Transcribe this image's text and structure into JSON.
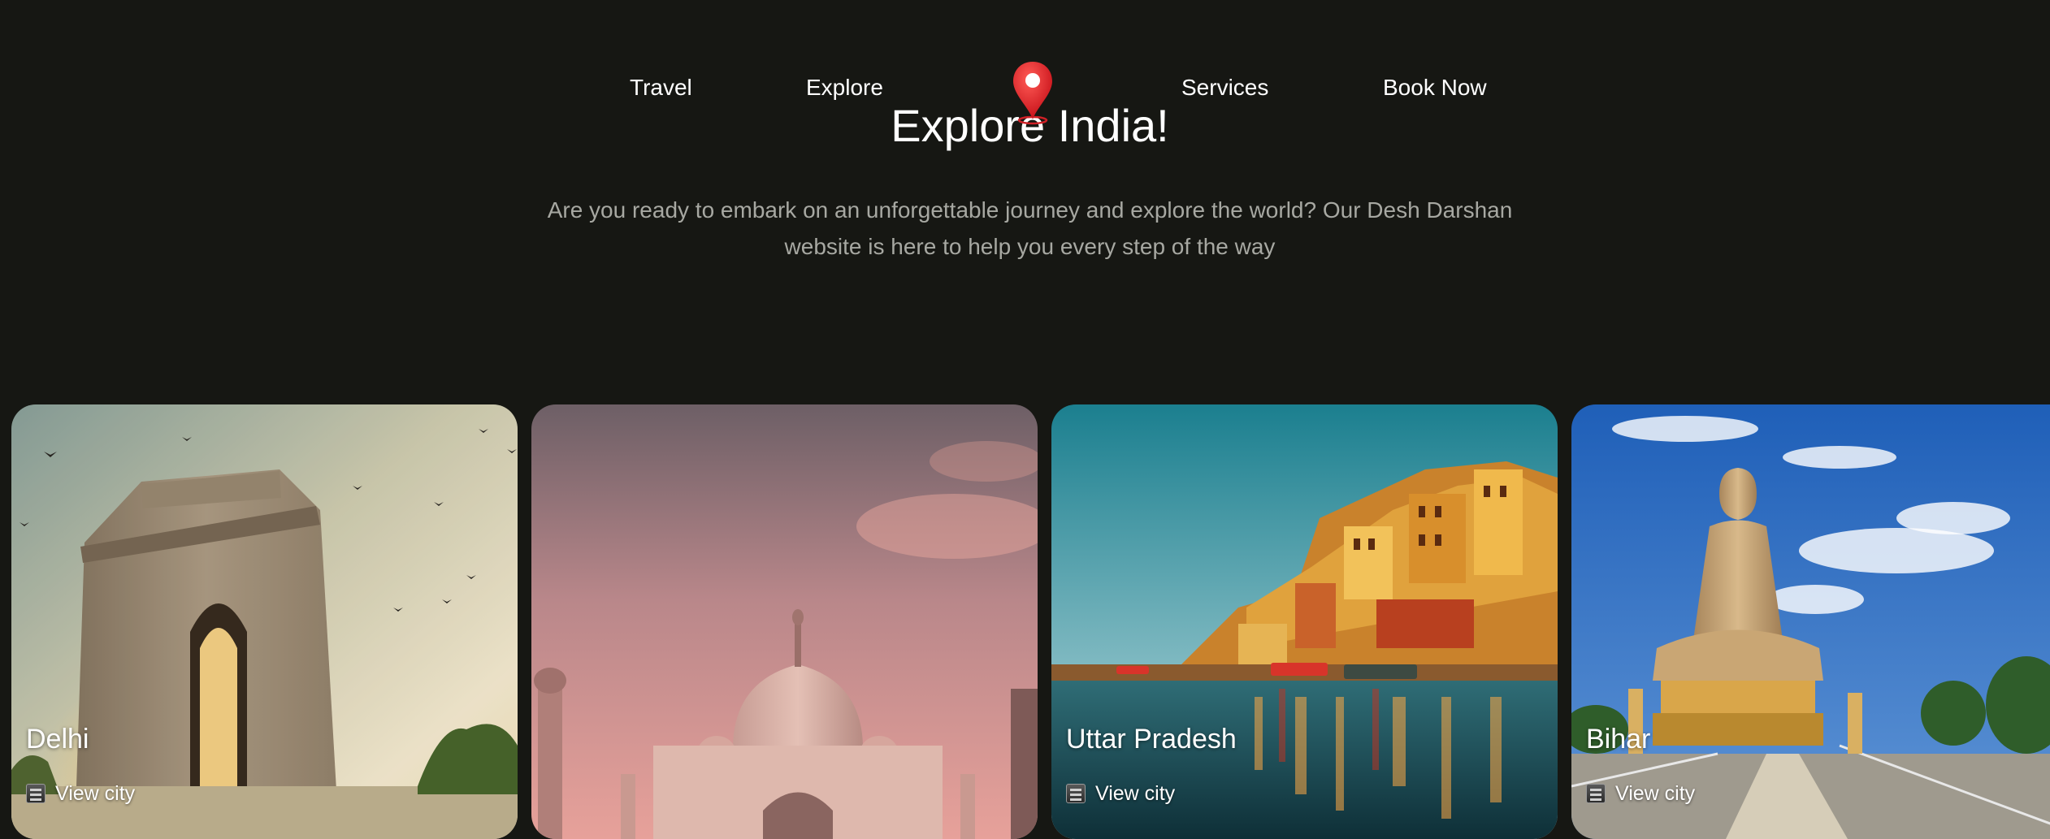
{
  "nav": {
    "items": [
      {
        "label": "Travel"
      },
      {
        "label": "Explore"
      },
      {
        "label": "Services"
      },
      {
        "label": "Book Now"
      }
    ]
  },
  "hero": {
    "title": "Explore India!",
    "description": "Are you ready to embark on an unforgettable journey and explore the world? Our Desh Darshan website is here to help you every step of the way"
  },
  "cards": [
    {
      "title": "Delhi",
      "link": "View city"
    },
    {
      "title": "",
      "link": ""
    },
    {
      "title": "Uttar Pradesh",
      "link": "View city"
    },
    {
      "title": "Bihar",
      "link": "View city"
    }
  ],
  "colors": {
    "background": "#161713",
    "text": "#ffffff",
    "muted": "#a7a8a2",
    "pin": "#e8262c"
  }
}
